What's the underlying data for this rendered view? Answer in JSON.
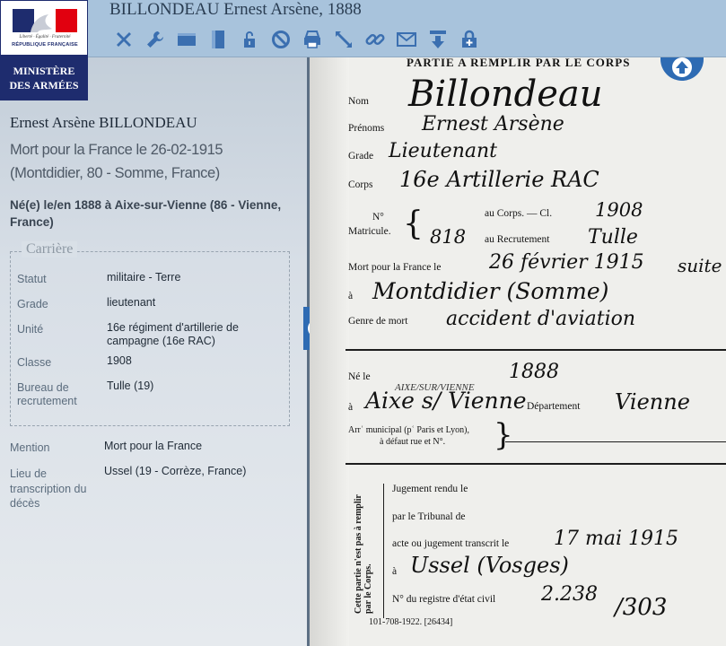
{
  "header": {
    "title": "BILLONDEAU Ernest Arsène, 1888",
    "tools": [
      {
        "icon": "close-icon"
      },
      {
        "icon": "wrench-icon"
      },
      {
        "icon": "horizontal-layout-icon"
      },
      {
        "icon": "vertical-layout-icon"
      },
      {
        "icon": "lock-icon"
      },
      {
        "icon": "block-icon"
      },
      {
        "icon": "print-icon"
      },
      {
        "icon": "expand-icon"
      },
      {
        "icon": "link-icon"
      },
      {
        "icon": "mail-icon"
      },
      {
        "icon": "download-icon"
      },
      {
        "icon": "add-lock-icon"
      }
    ]
  },
  "logo": {
    "motto": "Liberté · Égalité · Fraternité",
    "republic": "RÉPUBLIQUE FRANÇAISE",
    "ministry_line1": "MINISTÈRE",
    "ministry_line2": "DES ARMÉES"
  },
  "person": {
    "name": "Ernest Arsène BILLONDEAU",
    "death": "Mort pour la France le 26-02-1915 (Montdidier, 80 - Somme, France)",
    "birth": "Né(e) le/en 1888 à Aixe-sur-Vienne (86 - Vienne, France)"
  },
  "career": {
    "legend": "Carrière",
    "rows": [
      {
        "label": "Statut",
        "value": "militaire - Terre"
      },
      {
        "label": "Grade",
        "value": "lieutenant"
      },
      {
        "label": "Unité",
        "value": "16e régiment d'artillerie de campagne (16e RAC)"
      },
      {
        "label": "Classe",
        "value": "1908"
      },
      {
        "label": "Bureau de recrutement",
        "value": "Tulle (19)"
      }
    ]
  },
  "extra": [
    {
      "label": "Mention",
      "value": "Mort pour la France"
    },
    {
      "label": "Lieu de transcription du décès",
      "value": "Ussel (19 - Corrèze, France)"
    }
  ],
  "document": {
    "header": "PARTIE A REMPLIR PAR LE CORPS",
    "nom_label": "Nom",
    "nom_value": "Billondeau",
    "prenoms_label": "Prénoms",
    "prenoms_value": "Ernest Arsène",
    "grade_label": "Grade",
    "grade_value": "Lieutenant",
    "corps_label": "Corps",
    "corps_value": "16e Artillerie RAC",
    "no_label": "N°",
    "matricule_label": "Matricule.",
    "au_corps_label": "au Corps. — Cl.",
    "classe_value": "1908",
    "recrutement_no": "818",
    "au_recrutement_label": "au Recrutement",
    "recrutement_value": "Tulle",
    "mort_label": "Mort pour la France le",
    "mort_value": "26 février 1915",
    "mort_extra": "suite",
    "a1_label": "à",
    "lieu_mort_value": "Montdidier (Somme)",
    "genre_label": "Genre de mort",
    "genre_value": "accident d'aviation",
    "ne_label": "Né le",
    "ne_value": "1888",
    "a2_label": "à",
    "lieu_ne_value": "Aixe s/ Vienne",
    "lieu_ne_annot": "AIXE/SUR/VIENNE",
    "departement_label": "Département",
    "departement_value": "Vienne",
    "arr_label1": "Arrʿ municipal (pʿ Paris et Lyon),",
    "arr_label2": "à défaut rue et N°.",
    "side_note": "Cette partie n'est pas à remplir par le Corps.",
    "jugement_label": "Jugement rendu le",
    "tribunal_label": "par le Tribunal de",
    "acte_label": "acte ou jugement transcrit le",
    "acte_value": "17 mai 1915",
    "a3_label": "à",
    "transcription_value": "Ussel (Vosges)",
    "registre_label": "N° du registre d'état civil",
    "registre_value": "2.238",
    "registre_value2": "/303",
    "footer": "101-708-1922. [26434]"
  }
}
